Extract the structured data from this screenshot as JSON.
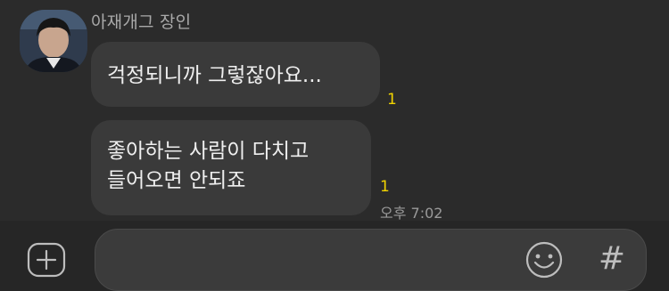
{
  "chat": {
    "sender_name": "아재개그 장인",
    "messages": [
      {
        "lines": [
          "걱정되니까 그렇잖아요..."
        ],
        "unread": "1"
      },
      {
        "lines": [
          "좋아하는 사람이 다치고",
          "들어오면 안되죠"
        ],
        "unread": "1",
        "time": "오후 7:02"
      }
    ]
  },
  "composer": {
    "placeholder": "",
    "add_icon": "plus-box-icon",
    "emoji_icon": "smiley-icon",
    "hash_label": "#"
  },
  "colors": {
    "background": "#2b2b2b",
    "bubble": "#3a3a3a",
    "unread": "#f2d400"
  }
}
